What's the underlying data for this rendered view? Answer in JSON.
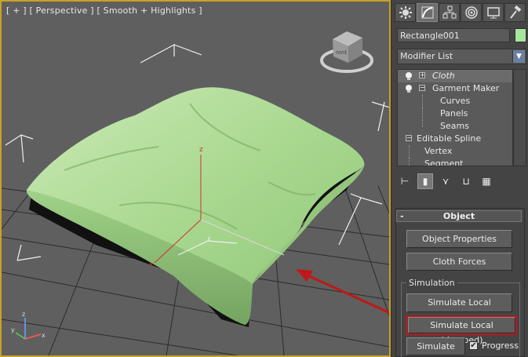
{
  "viewport": {
    "label": "[ + ] [ Perspective ] [ Smooth + Highlights ]",
    "viewcube": {
      "face_label": "ront"
    },
    "axis_labels": {
      "z": "z",
      "x": "x"
    },
    "gizmo_labels": {
      "z": "z",
      "x": "x",
      "y": "y"
    }
  },
  "command_panel": {
    "tabs": [
      {
        "name": "create-tab",
        "icon": "sun-gear-icon"
      },
      {
        "name": "modify-tab",
        "icon": "bend-curve-icon",
        "active": true
      },
      {
        "name": "hierarchy-tab",
        "icon": "hierarchy-icon"
      },
      {
        "name": "motion-tab",
        "icon": "motion-circle-icon"
      },
      {
        "name": "display-tab",
        "icon": "monitor-icon"
      },
      {
        "name": "utilities-tab",
        "icon": "hammer-icon"
      }
    ],
    "object_name": "Rectangle001",
    "object_color": "#a8e6a0",
    "modifier_list_label": "Modifier List",
    "stack": [
      {
        "label": "Cloth",
        "selected": true,
        "indent": 0
      },
      {
        "label": "Garment Maker",
        "indent": 0
      },
      {
        "label": "Curves",
        "indent": 1
      },
      {
        "label": "Panels",
        "indent": 1
      },
      {
        "label": "Seams",
        "indent": 1
      },
      {
        "label": "Editable Spline",
        "indent": 0
      },
      {
        "label": "Vertex",
        "indent": 1
      },
      {
        "label": "Segment",
        "indent": 1
      }
    ],
    "rollout": {
      "title": "Object",
      "collapse_symbol": "-",
      "object_properties": "Object Properties",
      "cloth_forces": "Cloth Forces",
      "simulation_group": "Simulation",
      "simulate_local": "Simulate Local",
      "simulate_local_damped": "Simulate Local (damped)",
      "simulate": "Simulate",
      "progress_label": "Progress",
      "progress_checked": true
    }
  },
  "colors": {
    "viewport_bg": "#5f5f5f",
    "active_border": "#c9a227",
    "cloth": "#a8d98f",
    "annotation_red": "#c01818"
  }
}
